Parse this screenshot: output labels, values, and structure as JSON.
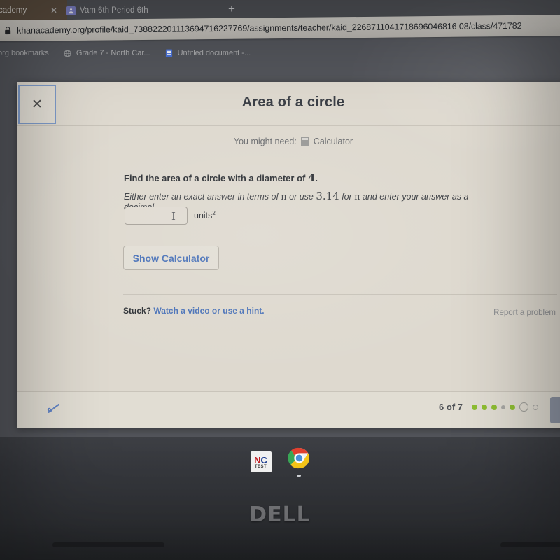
{
  "browser": {
    "tabs": [
      {
        "title": "cademy",
        "favicon": "khan-academy-favicon",
        "active": true,
        "close_label": "✕"
      },
      {
        "title": "Vam 6th Period 6th",
        "favicon": "profile-favicon",
        "active": false
      }
    ],
    "new_tab_label": "+",
    "address_bar": {
      "secure_icon": "lock-icon",
      "url": "khanacademy.org/profile/kaid_738822201113694716227769/assignments/teacher/kaid_2268711041718696046816 08/class/471782"
    },
    "bookmarks": [
      {
        "label": ".org bookmarks",
        "icon": "folder-icon"
      },
      {
        "label": "Grade 7 - North Car...",
        "icon": "site-icon"
      },
      {
        "label": "Untitled document -...",
        "icon": "google-docs-icon"
      }
    ]
  },
  "exercise": {
    "close_label": "✕",
    "title": "Area of a circle",
    "calculator_hint_prefix": "You might need:",
    "calculator_label": "Calculator",
    "question": {
      "line1_prefix": "Find the area of a circle with a diameter of ",
      "line1_value": "4",
      "line1_suffix": ".",
      "line2_part1": "Either enter an exact answer in terms of ",
      "line2_pi1": "π",
      "line2_part2": " or use ",
      "line2_value": "3.14",
      "line2_part3": " for ",
      "line2_pi2": "π",
      "line2_part4": " and enter your answer as a decimal."
    },
    "answer": {
      "value": "",
      "placeholder": "",
      "units_text": "units",
      "units_exponent": "2",
      "caret_glyph": "I"
    },
    "show_calculator_label": "Show Calculator",
    "stuck_prefix": "Stuck?",
    "stuck_link_label": "Watch a video or use a hint.",
    "report_problem_label": "Report a problem",
    "footer": {
      "scratchpad_icon": "scratchpad-pencil-icon",
      "progress_label": "6 of 7",
      "progress_dots": [
        "correct",
        "correct",
        "correct",
        "skipped",
        "correct",
        "current",
        "upcoming"
      ],
      "check_answer_icon": "check-answer-button"
    }
  },
  "taskbar": {
    "items": [
      {
        "name": "nc-test-app",
        "label_top": "N",
        "label_top2": "C",
        "label_bottom": "TEST"
      },
      {
        "name": "chrome-app",
        "label": "Google Chrome"
      }
    ]
  },
  "device": {
    "brand_logo": "DELL"
  },
  "colors": {
    "khan_green": "#8ebe32",
    "link_blue": "#4a72b8",
    "focus_blue": "#7e9bc9",
    "card_bg": "#ded9cf"
  }
}
